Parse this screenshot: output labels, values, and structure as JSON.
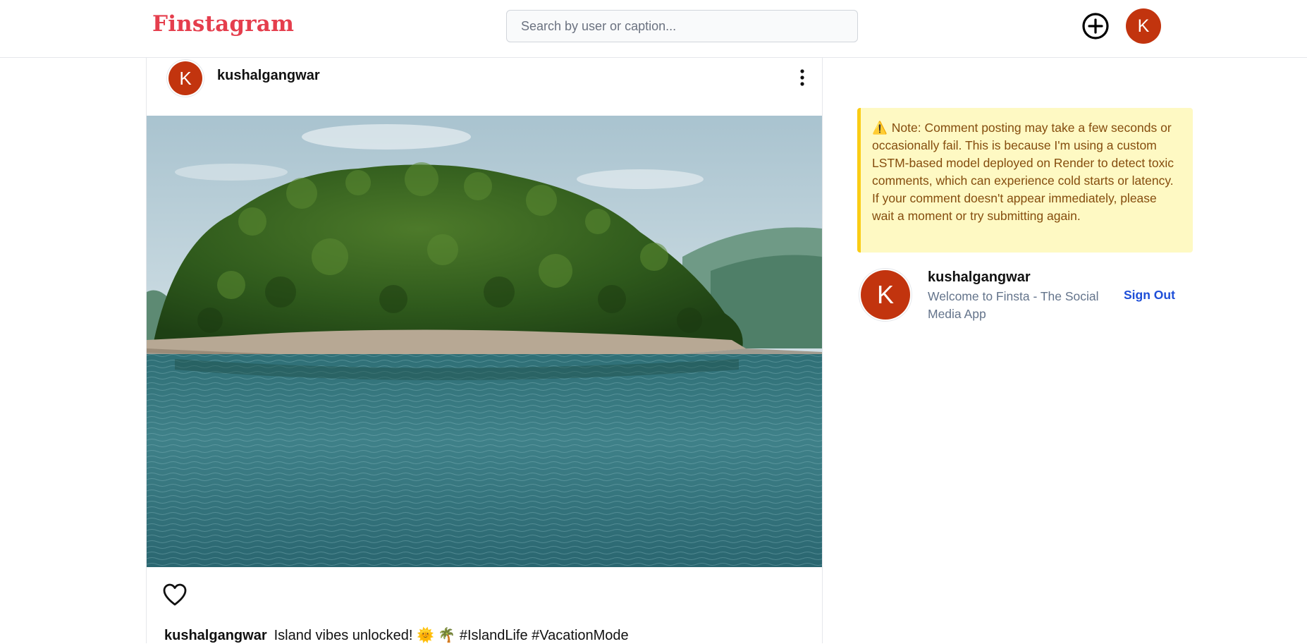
{
  "header": {
    "logo": "Finstagram",
    "search_placeholder": "Search by user or caption...",
    "avatar_initial": "K"
  },
  "post": {
    "avatar_initial": "K",
    "username": "kushalgangwar",
    "image_alt": "Forested island in a lake",
    "caption_user": "kushalgangwar",
    "caption_text": "Island vibes unlocked! 🌞 🌴 #IslandLife #VacationMode"
  },
  "sidebar": {
    "note_icon": "⚠️",
    "note_text": "Note: Comment posting may take a few seconds or occasionally fail. This is because I'm using a custom LSTM-based model deployed on Render to detect toxic comments, which can experience cold starts or latency. If your comment doesn't appear immediately, please wait a moment or try submitting again.",
    "profile": {
      "avatar_initial": "K",
      "username": "kushalgangwar",
      "subtitle": "Welcome to Finsta - The Social Media App",
      "signout_label": "Sign Out"
    }
  },
  "icons": {
    "add": "plus-circle-icon",
    "menu": "kebab-menu-icon",
    "like": "heart-icon",
    "warning": "warning-icon"
  },
  "colors": {
    "brand": "#e53e4d",
    "avatar": "#c2340e",
    "note_bg": "#fef9c3",
    "note_border": "#facc15",
    "link": "#1d4ed8"
  }
}
